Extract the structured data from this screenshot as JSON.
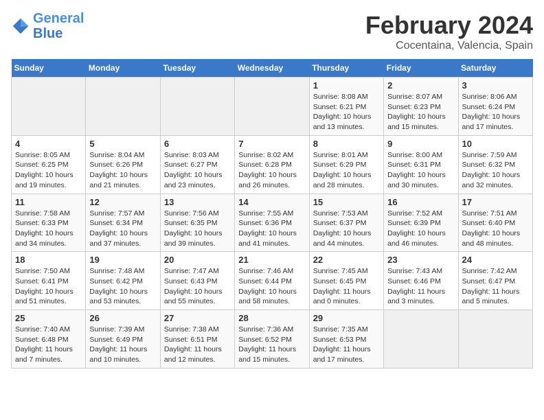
{
  "header": {
    "logo_line1": "General",
    "logo_line2": "Blue",
    "month_title": "February 2024",
    "location": "Cocentaina, Valencia, Spain"
  },
  "weekdays": [
    "Sunday",
    "Monday",
    "Tuesday",
    "Wednesday",
    "Thursday",
    "Friday",
    "Saturday"
  ],
  "weeks": [
    [
      {
        "day": "",
        "info": ""
      },
      {
        "day": "",
        "info": ""
      },
      {
        "day": "",
        "info": ""
      },
      {
        "day": "",
        "info": ""
      },
      {
        "day": "1",
        "info": "Sunrise: 8:08 AM\nSunset: 6:21 PM\nDaylight: 10 hours\nand 13 minutes."
      },
      {
        "day": "2",
        "info": "Sunrise: 8:07 AM\nSunset: 6:23 PM\nDaylight: 10 hours\nand 15 minutes."
      },
      {
        "day": "3",
        "info": "Sunrise: 8:06 AM\nSunset: 6:24 PM\nDaylight: 10 hours\nand 17 minutes."
      }
    ],
    [
      {
        "day": "4",
        "info": "Sunrise: 8:05 AM\nSunset: 6:25 PM\nDaylight: 10 hours\nand 19 minutes."
      },
      {
        "day": "5",
        "info": "Sunrise: 8:04 AM\nSunset: 6:26 PM\nDaylight: 10 hours\nand 21 minutes."
      },
      {
        "day": "6",
        "info": "Sunrise: 8:03 AM\nSunset: 6:27 PM\nDaylight: 10 hours\nand 23 minutes."
      },
      {
        "day": "7",
        "info": "Sunrise: 8:02 AM\nSunset: 6:28 PM\nDaylight: 10 hours\nand 26 minutes."
      },
      {
        "day": "8",
        "info": "Sunrise: 8:01 AM\nSunset: 6:29 PM\nDaylight: 10 hours\nand 28 minutes."
      },
      {
        "day": "9",
        "info": "Sunrise: 8:00 AM\nSunset: 6:31 PM\nDaylight: 10 hours\nand 30 minutes."
      },
      {
        "day": "10",
        "info": "Sunrise: 7:59 AM\nSunset: 6:32 PM\nDaylight: 10 hours\nand 32 minutes."
      }
    ],
    [
      {
        "day": "11",
        "info": "Sunrise: 7:58 AM\nSunset: 6:33 PM\nDaylight: 10 hours\nand 34 minutes."
      },
      {
        "day": "12",
        "info": "Sunrise: 7:57 AM\nSunset: 6:34 PM\nDaylight: 10 hours\nand 37 minutes."
      },
      {
        "day": "13",
        "info": "Sunrise: 7:56 AM\nSunset: 6:35 PM\nDaylight: 10 hours\nand 39 minutes."
      },
      {
        "day": "14",
        "info": "Sunrise: 7:55 AM\nSunset: 6:36 PM\nDaylight: 10 hours\nand 41 minutes."
      },
      {
        "day": "15",
        "info": "Sunrise: 7:53 AM\nSunset: 6:37 PM\nDaylight: 10 hours\nand 44 minutes."
      },
      {
        "day": "16",
        "info": "Sunrise: 7:52 AM\nSunset: 6:39 PM\nDaylight: 10 hours\nand 46 minutes."
      },
      {
        "day": "17",
        "info": "Sunrise: 7:51 AM\nSunset: 6:40 PM\nDaylight: 10 hours\nand 48 minutes."
      }
    ],
    [
      {
        "day": "18",
        "info": "Sunrise: 7:50 AM\nSunset: 6:41 PM\nDaylight: 10 hours\nand 51 minutes."
      },
      {
        "day": "19",
        "info": "Sunrise: 7:48 AM\nSunset: 6:42 PM\nDaylight: 10 hours\nand 53 minutes."
      },
      {
        "day": "20",
        "info": "Sunrise: 7:47 AM\nSunset: 6:43 PM\nDaylight: 10 hours\nand 55 minutes."
      },
      {
        "day": "21",
        "info": "Sunrise: 7:46 AM\nSunset: 6:44 PM\nDaylight: 10 hours\nand 58 minutes."
      },
      {
        "day": "22",
        "info": "Sunrise: 7:45 AM\nSunset: 6:45 PM\nDaylight: 11 hours\nand 0 minutes."
      },
      {
        "day": "23",
        "info": "Sunrise: 7:43 AM\nSunset: 6:46 PM\nDaylight: 11 hours\nand 3 minutes."
      },
      {
        "day": "24",
        "info": "Sunrise: 7:42 AM\nSunset: 6:47 PM\nDaylight: 11 hours\nand 5 minutes."
      }
    ],
    [
      {
        "day": "25",
        "info": "Sunrise: 7:40 AM\nSunset: 6:48 PM\nDaylight: 11 hours\nand 7 minutes."
      },
      {
        "day": "26",
        "info": "Sunrise: 7:39 AM\nSunset: 6:49 PM\nDaylight: 11 hours\nand 10 minutes."
      },
      {
        "day": "27",
        "info": "Sunrise: 7:38 AM\nSunset: 6:51 PM\nDaylight: 11 hours\nand 12 minutes."
      },
      {
        "day": "28",
        "info": "Sunrise: 7:36 AM\nSunset: 6:52 PM\nDaylight: 11 hours\nand 15 minutes."
      },
      {
        "day": "29",
        "info": "Sunrise: 7:35 AM\nSunset: 6:53 PM\nDaylight: 11 hours\nand 17 minutes."
      },
      {
        "day": "",
        "info": ""
      },
      {
        "day": "",
        "info": ""
      }
    ]
  ]
}
